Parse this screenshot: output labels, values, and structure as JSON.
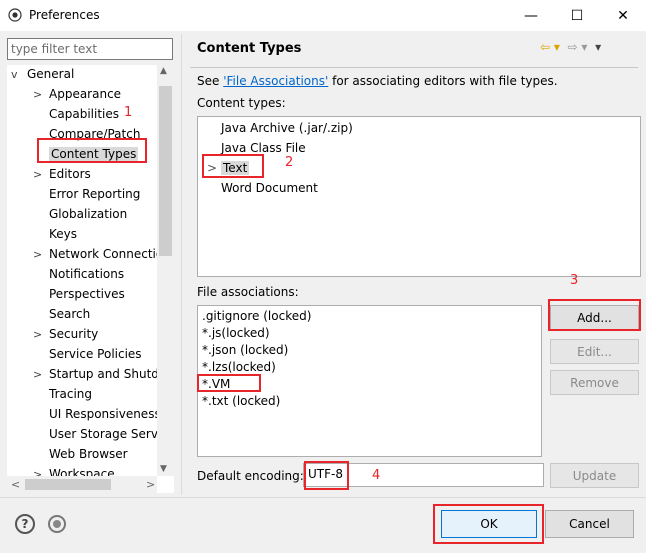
{
  "window": {
    "title": "Preferences",
    "minimize_glyph": "—",
    "maximize_glyph": "☐",
    "close_glyph": "✕"
  },
  "left": {
    "filter_placeholder": "type filter text",
    "tree": [
      {
        "label": "General",
        "twisty": "v"
      },
      {
        "label": "Appearance",
        "twisty": ">"
      },
      {
        "label": "Capabilities",
        "twisty": ""
      },
      {
        "label": "Compare/Patch",
        "twisty": ""
      },
      {
        "label": "Content Types",
        "twisty": "",
        "selected": true
      },
      {
        "label": "Editors",
        "twisty": ">"
      },
      {
        "label": "Error Reporting",
        "twisty": ""
      },
      {
        "label": "Globalization",
        "twisty": ""
      },
      {
        "label": "Keys",
        "twisty": ""
      },
      {
        "label": "Network Connectio",
        "twisty": ">"
      },
      {
        "label": "Notifications",
        "twisty": ""
      },
      {
        "label": "Perspectives",
        "twisty": ""
      },
      {
        "label": "Search",
        "twisty": ""
      },
      {
        "label": "Security",
        "twisty": ">"
      },
      {
        "label": "Service Policies",
        "twisty": ""
      },
      {
        "label": "Startup and Shutd",
        "twisty": ">"
      },
      {
        "label": "Tracing",
        "twisty": ""
      },
      {
        "label": "UI Responsiveness",
        "twisty": ""
      },
      {
        "label": "User Storage Serv",
        "twisty": ""
      },
      {
        "label": "Web Browser",
        "twisty": ""
      },
      {
        "label": "Workspace",
        "twisty": ">"
      }
    ],
    "scroll_left": "<",
    "scroll_right": ">"
  },
  "right": {
    "title": "Content Types",
    "nav_back": "⇦ ▾",
    "nav_forward": "⇨ ▾",
    "nav_menu": "▾",
    "see_prefix": "See ",
    "see_link": "'File Associations'",
    "see_suffix": " for associating editors with file types.",
    "content_types_label": "Content types:",
    "content_types": [
      {
        "label": "Java Archive (.jar/.zip)",
        "twisty": ""
      },
      {
        "label": "Java Class File",
        "twisty": ""
      },
      {
        "label": "Text",
        "twisty": ">",
        "selected": true
      },
      {
        "label": "Word Document",
        "twisty": ""
      }
    ],
    "file_assoc_label": "File associations:",
    "file_associations": [
      ".gitignore (locked)",
      "*.js(locked)",
      "*.json  (locked)",
      "*.lzs(locked)",
      "*.VM",
      "*.txt (locked)"
    ],
    "buttons": {
      "add": "Add...",
      "edit": "Edit...",
      "remove": "Remove",
      "update": "Update"
    },
    "encoding_label": "Default encoding:",
    "encoding_value": "UTF-8"
  },
  "annotations": {
    "n1": "1",
    "n2": "2",
    "n3": "3",
    "n4": "4"
  },
  "footer": {
    "help_glyph": "?",
    "ok": "OK",
    "cancel": "Cancel"
  }
}
